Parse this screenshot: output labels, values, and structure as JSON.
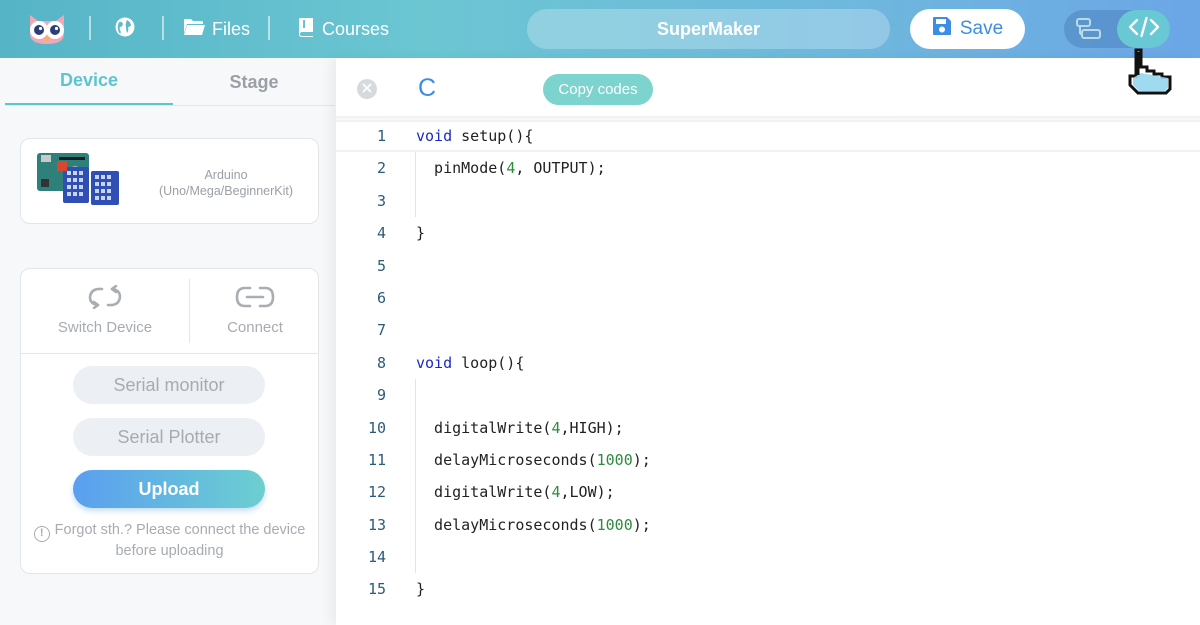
{
  "topbar": {
    "files_label": "Files",
    "courses_label": "Courses",
    "project_title": "SuperMaker",
    "save_label": "Save"
  },
  "left_panel": {
    "tabs": [
      {
        "label": "Device",
        "active": true
      },
      {
        "label": "Stage",
        "active": false
      }
    ],
    "device": {
      "name": "Arduino",
      "variants": "(Uno/Mega/BeginnerKit)"
    },
    "actions": {
      "switch_device_label": "Switch Device",
      "connect_label": "Connect",
      "serial_monitor_label": "Serial monitor",
      "serial_plotter_label": "Serial Plotter",
      "upload_label": "Upload",
      "hint": "Forgot sth.? Please connect the device before uploading"
    }
  },
  "editor": {
    "language": "C",
    "copy_label": "Copy codes",
    "lines": [
      {
        "n": "1",
        "text": "void setup(){"
      },
      {
        "n": "2",
        "text": "  pinMode(4, OUTPUT);"
      },
      {
        "n": "3",
        "text": ""
      },
      {
        "n": "4",
        "text": "}"
      },
      {
        "n": "5",
        "text": ""
      },
      {
        "n": "6",
        "text": ""
      },
      {
        "n": "7",
        "text": ""
      },
      {
        "n": "8",
        "text": "void loop(){"
      },
      {
        "n": "9",
        "text": ""
      },
      {
        "n": "10",
        "text": "  digitalWrite(4,HIGH);"
      },
      {
        "n": "11",
        "text": "  delayMicroseconds(1000);"
      },
      {
        "n": "12",
        "text": "  digitalWrite(4,LOW);"
      },
      {
        "n": "13",
        "text": "  delayMicroseconds(1000);"
      },
      {
        "n": "14",
        "text": ""
      },
      {
        "n": "15",
        "text": "}"
      }
    ]
  },
  "colors": {
    "accent": "#5cc5d0",
    "save_text": "#3d8de5",
    "keyword": "#1a28c8",
    "number": "#2e8b3e"
  },
  "icons": {
    "logo": "owl-logo-icon",
    "globe": "globe-icon",
    "files": "folder-icon",
    "courses": "book-icon",
    "save": "floppy-disk-icon",
    "blocks_view": "blocks-view-icon",
    "code_view": "code-brackets-icon",
    "close": "close-icon",
    "switch": "switch-arrows-icon",
    "connect": "link-icon",
    "hint": "exclamation-circle-icon",
    "cursor": "hand-pointer-icon"
  }
}
